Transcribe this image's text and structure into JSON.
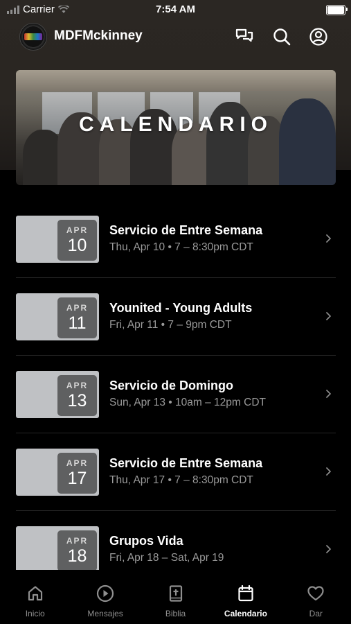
{
  "status_bar": {
    "carrier": "Carrier",
    "time": "7:54 AM"
  },
  "header": {
    "app_name": "MDFMckinney"
  },
  "banner": {
    "title": "CALENDARIO"
  },
  "events": [
    {
      "month": "APR",
      "day": "10",
      "title": "Servicio de Entre Semana",
      "subtitle": "Thu, Apr 10 • 7 – 8:30pm CDT"
    },
    {
      "month": "APR",
      "day": "11",
      "title": "Younited - Young Adults",
      "subtitle": "Fri, Apr 11 • 7 – 9pm CDT"
    },
    {
      "month": "APR",
      "day": "13",
      "title": "Servicio de Domingo",
      "subtitle": "Sun, Apr 13 • 10am – 12pm CDT"
    },
    {
      "month": "APR",
      "day": "17",
      "title": "Servicio de Entre Semana",
      "subtitle": "Thu, Apr 17 • 7 – 8:30pm CDT"
    },
    {
      "month": "APR",
      "day": "18",
      "title": "Grupos Vida",
      "subtitle": "Fri, Apr 18 – Sat, Apr 19"
    }
  ],
  "tabs": [
    {
      "label": "Inicio",
      "icon": "home-icon",
      "active": false
    },
    {
      "label": "Mensajes",
      "icon": "play-icon",
      "active": false
    },
    {
      "label": "Biblia",
      "icon": "bible-icon",
      "active": false
    },
    {
      "label": "Calendario",
      "icon": "calendar-icon",
      "active": true
    },
    {
      "label": "Dar",
      "icon": "heart-icon",
      "active": false
    }
  ],
  "colors": {
    "background": "#000000",
    "subtitle": "#9a9a9a",
    "date_box": "#5f6061",
    "thumbnail": "#bfc1c4"
  }
}
